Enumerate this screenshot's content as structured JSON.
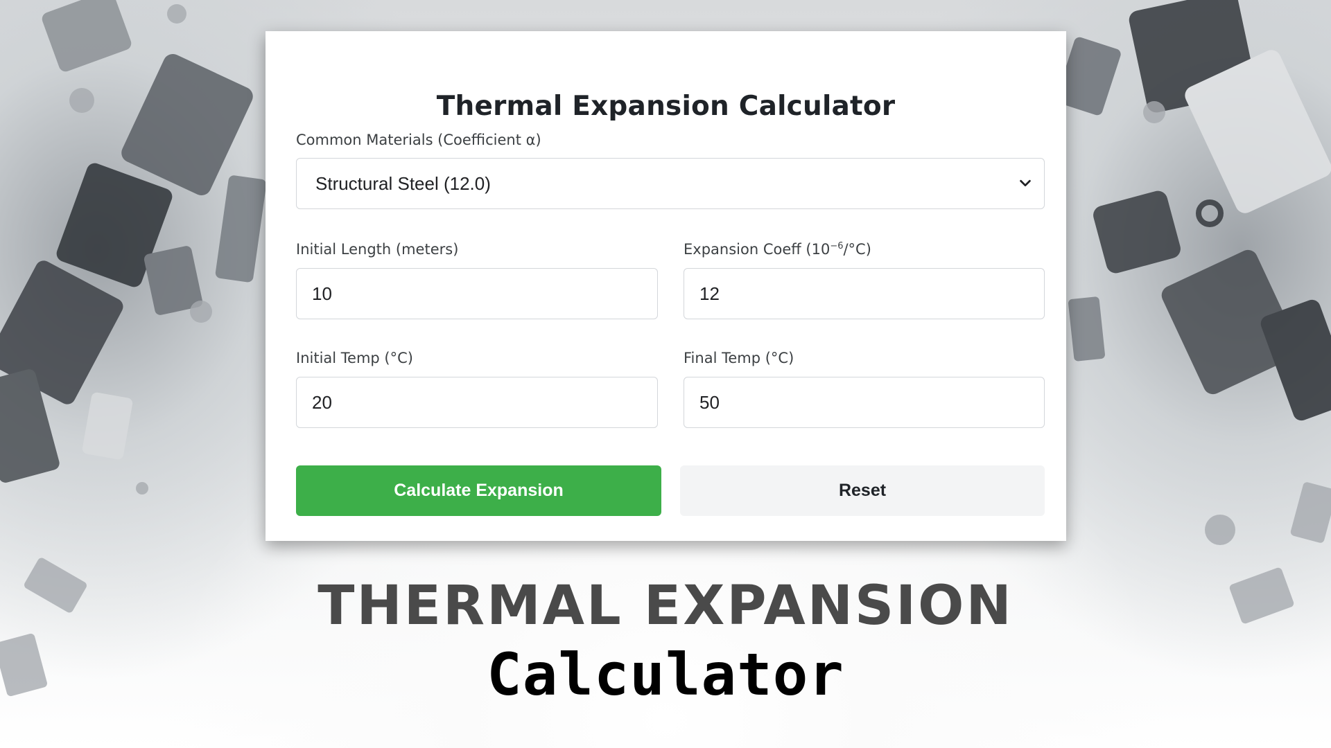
{
  "card": {
    "title": "Thermal Expansion Calculator"
  },
  "materials": {
    "label": "Common Materials (Coefficient α)",
    "selected": "Structural Steel (12.0)"
  },
  "initial_length": {
    "label": "Initial Length (meters)",
    "value": "10"
  },
  "expansion_coeff": {
    "label_prefix": "Expansion Coeff (10",
    "label_exponent": "−6",
    "label_suffix": "/°C)",
    "value": "12"
  },
  "initial_temp": {
    "label": "Initial Temp (°C)",
    "value": "20"
  },
  "final_temp": {
    "label": "Final Temp (°C)",
    "value": "50"
  },
  "buttons": {
    "calculate": "Calculate Expansion",
    "reset": "Reset"
  },
  "banner": {
    "headline": "THERMAL EXPANSION",
    "subline": "Calculator"
  },
  "colors": {
    "primary_button": "#3daf49",
    "secondary_button": "#f3f4f5",
    "headline_text": "#4a4a4a"
  },
  "icons": {
    "select_arrow": "chevron-down-icon"
  }
}
